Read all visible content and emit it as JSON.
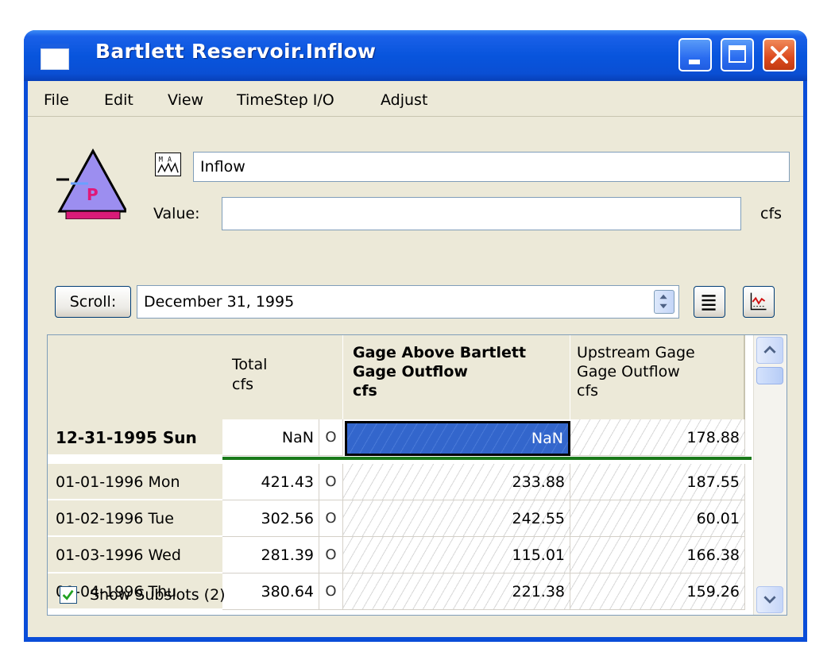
{
  "window": {
    "title": "Bartlett Reservoir.Inflow",
    "colors": {
      "titlebar": "#0a4dd8",
      "client": "#ece9d8",
      "selected_cell": "#3366cc",
      "current_row_line": "#1a7a1a"
    }
  },
  "menu": [
    "File",
    "Edit",
    "View",
    "TimeStep I/O",
    "Adjust"
  ],
  "slot": {
    "name": "Inflow",
    "value_label": "Value:",
    "value": "",
    "unit": "cfs",
    "object_icon": "reservoir-icon",
    "slot_icon": "series-slot-icon"
  },
  "scroll": {
    "button_label": "Scroll:",
    "date": "December 31, 1995"
  },
  "grid": {
    "columns": [
      {
        "lines": [
          "Total",
          "cfs"
        ],
        "bold": false
      },
      {
        "lines": [
          "Gage Above Bartlett",
          "Gage Outflow",
          "cfs"
        ],
        "bold": true
      },
      {
        "lines": [
          "Upstream Gage",
          "Gage Outflow",
          "cfs"
        ],
        "bold": false
      }
    ],
    "rows": [
      {
        "date": "12-31-1995 Sun",
        "current": true,
        "total": "NaN",
        "flag": "O",
        "bartlett": "NaN",
        "upstream": "178.88"
      },
      {
        "date": "01-01-1996 Mon",
        "current": false,
        "total": "421.43",
        "flag": "O",
        "bartlett": "233.88",
        "upstream": "187.55"
      },
      {
        "date": "01-02-1996 Tue",
        "current": false,
        "total": "302.56",
        "flag": "O",
        "bartlett": "242.55",
        "upstream": "60.01"
      },
      {
        "date": "01-03-1996 Wed",
        "current": false,
        "total": "281.39",
        "flag": "O",
        "bartlett": "115.01",
        "upstream": "166.38"
      },
      {
        "date": "01-04-1996 Thu",
        "current": false,
        "total": "380.64",
        "flag": "O",
        "bartlett": "221.38",
        "upstream": "159.26"
      }
    ]
  },
  "show_subslots": {
    "label": "Show Subslots (2)",
    "checked": true
  }
}
